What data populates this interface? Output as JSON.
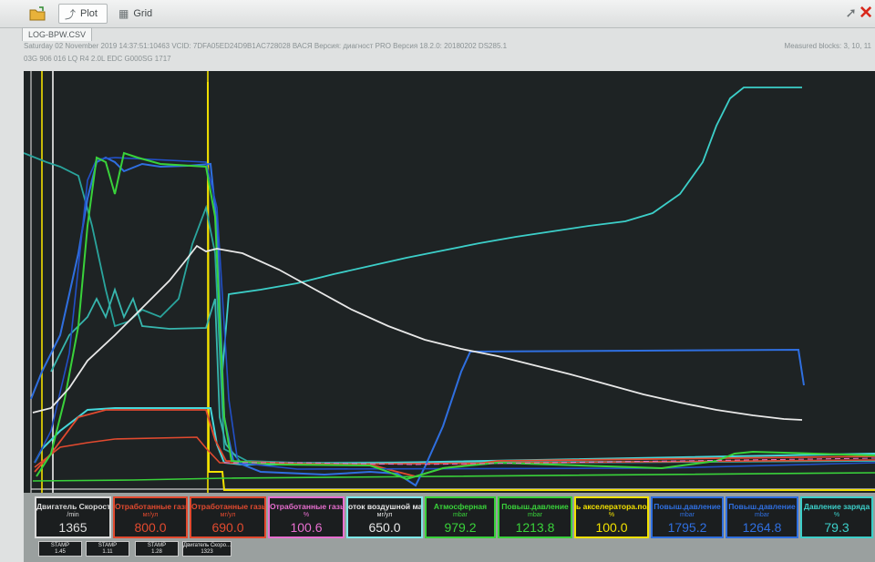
{
  "toolbar": {
    "plot_label": "Plot",
    "grid_label": "Grid"
  },
  "file_tab": "LOG-BPW.CSV",
  "info": {
    "line1": "Saturday 02 November 2019 14:37:51:10463 VCID: 7DFA05ED24D9B1AC728028 ВАСЯ Версия: диагност PRO Версия 18.2.0: 20180202 DS285.1",
    "line2": "03G 906 016 LQ   R4 2.0L EDC G000SG  1717",
    "measured_blocks": "Measured blocks: 3, 10, 11"
  },
  "colors": {
    "background": "#1e2324",
    "white": "#e8e8e8",
    "cyan": "#3ccfc9",
    "teal": "#2aa59d",
    "green": "#39d23a",
    "blue": "#2f6fe0",
    "red": "#e24a2f",
    "yellow": "#f2e100",
    "pink": "#e86fd0"
  },
  "gauges": [
    {
      "name": "Двигатель Скорость",
      "unit": "/min",
      "value": "1365",
      "color": "#dcdcdc"
    },
    {
      "name": "Отработанные газы",
      "unit": "мг/ул",
      "value": "800.0",
      "color": "#e24a2f"
    },
    {
      "name": "Отработанные газы",
      "unit": "мг/ул",
      "value": "690.0",
      "color": "#e24a2f"
    },
    {
      "name": "Отработанные газы",
      "unit": "%",
      "value": "100.6",
      "color": "#e86fd0"
    },
    {
      "name": "оток воздушной масс",
      "unit": "мг/ул",
      "value": "650.0",
      "color": "#7ee8e8"
    },
    {
      "name": "Атмосферная",
      "unit": "mbar",
      "value": "979.2",
      "color": "#39d23a"
    },
    {
      "name": "Повыш.давление",
      "unit": "mbar",
      "value": "1213.8",
      "color": "#39d23a"
    },
    {
      "name": "ь акселератора.поло",
      "unit": "%",
      "value": "100.0",
      "color": "#f2e100"
    },
    {
      "name": "Повыш.давление",
      "unit": "mbar",
      "value": "1795.2",
      "color": "#2f6fe0"
    },
    {
      "name": "Повыш.давление",
      "unit": "mbar",
      "value": "1264.8",
      "color": "#2f6fe0"
    },
    {
      "name": "Давление заряда",
      "unit": "%",
      "value": "79.3",
      "color": "#3ccfc9"
    }
  ],
  "stamps": [
    {
      "label": "STAMP",
      "value": "1.45"
    },
    {
      "label": "STAMP",
      "value": "1.11"
    },
    {
      "label": "STAMP",
      "value": "1.28"
    },
    {
      "label": "Двигатель Скоро...",
      "value": "1323"
    }
  ]
}
